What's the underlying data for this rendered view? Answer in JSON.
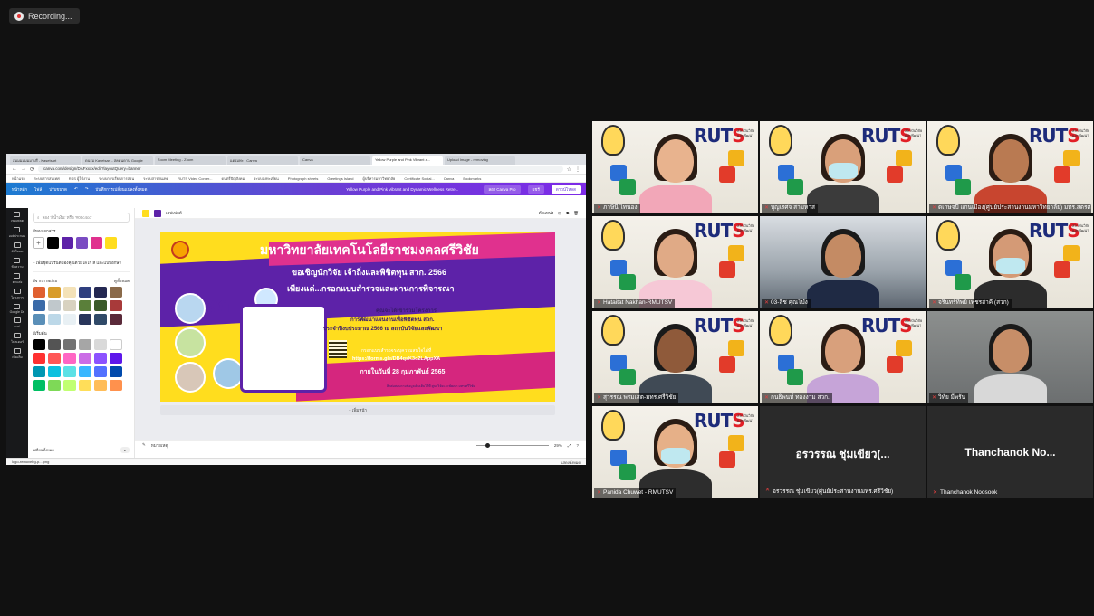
{
  "recording": {
    "label": "Recording..."
  },
  "share": {
    "tabs": [
      "สมมมมมมมาปรี - Kasetsart",
      "ดนรม Kasetsart - สคดนดาน Google",
      "Zoom Meeting - Zoom",
      "แดรมพะ - Canva",
      "Canva",
      "Yellow Purple and Pink Vibrant a...",
      "Upload Image - removing"
    ],
    "address": "canva.com/design/DAFxxxx/edit?layoutQuery=banner",
    "bookmarks": [
      "หน้าแรก",
      "ระบบสารสนเทศ",
      "RSS ผู้ใช้งาน",
      "ระบบการเรียนการสอน",
      "ระบบสารสนเทศ",
      "RUTS Video Confer...",
      "ดนตรีปัญสังคม",
      "ระบบลงทะเบียน",
      "Photograph sheets",
      "Greetings Island",
      "ผู้บริหารมหาวิทยาลัย",
      "Certificate Social...",
      "Canva",
      "Bookmarks"
    ],
    "canva": {
      "home": "หน้าหลัก",
      "file": "ไฟล์",
      "resize": "ปรับขนาด",
      "saved": "บันทึกการเปลี่ยนแปลงทั้งหมด",
      "doc_title": "Yellow Purple and Pink Vibrant and Dynamic Wellness Retre...",
      "try_pro": "ลอง Canva Pro",
      "share_btn": "แชร์",
      "download_btn": "ดาวน์โหลด",
      "rail": [
        "เทมเพลต",
        "องค์ประกอบ",
        "อัปโหลด",
        "ข้อความ",
        "ตกแต่ง",
        "โครงการ",
        "Google Dr.",
        "แอป",
        "โฟลเดอร์",
        "เพิ่มเติม"
      ],
      "search_placeholder": "ลอง 'สีน้ำเงิน' หรือ '#00c4cc'",
      "doc_colors_label": "สีของเอกสาร",
      "brand_link": "เพิ่มชุดแบรนด์ของคุณด้วยโลโก้ สี และแบบอักษร",
      "photo_colors_label": "สีจากภาพถ่าย",
      "photo_colors_more": "ดูทั้งหมด",
      "default_colors_label": "สีเริ่มต้น",
      "change_all": "เปลี่ยนทั้งหมด",
      "toolbar_effects": "เอฟเฟกต์",
      "toolbar_position": "ตำแหน่ง",
      "add_page": "+ เพิ่มหน้า",
      "notes": "หมายเหตุ",
      "zoom": "29%",
      "download_file": "logo-removebg-p....png",
      "show_all": "แสดงทั้งหมด",
      "banner": {
        "university": "มหาวิทยาลัยเทคโนโลยีราชมงคลศรีวิชัย",
        "invite": "ขอเชิญนักวิจัย เจ้าถิ่งและพิชิตทุน สวก. 2566",
        "only": "เพียงแค่...กรอกแบบสำรวจและผ่านการพิจารณา",
        "line1": "คุณจะได้เข้าร่วมโครงการ",
        "line2": "การพัฒนาแผนงานเพื่อพิชิตทุน สวก.",
        "line3": "ประจำปีงบประมาณ 2566 ณ สถาบันวิจัยและพัฒนา",
        "survey": "กรอกแบบสำรวจระบุความสนใจได้ที่",
        "link": "https://forms.gle/DB4qsK3o2LAppXA",
        "deadline": "ภายในวันที่ 28 กุมภาพันธ์ 2565",
        "contact": "ติดต่อสอบถามข้อมูลเพิ่มเติมได้ที่ ศูนย์วิจัยและพัฒนา มทร.ศรีวิชัย"
      }
    },
    "colors": {
      "doc": [
        "#000000",
        "#5d22a8",
        "#7a4cc2",
        "#e0318e",
        "#ffdd1e"
      ],
      "photo": [
        "#e06030",
        "#d89c2a",
        "#f4e2b8",
        "#2f3f7f",
        "#242852",
        "#8a6a4a",
        "#3a6aa8",
        "#c0c8cc",
        "#d8d2c0",
        "#5a7f3a",
        "#3a5a2a",
        "#a83a3a",
        "#5a8fb8",
        "#bcd8e8",
        "#e8f0f4",
        "#28355a",
        "#304a68",
        "#5a2a3a"
      ],
      "default": [
        "#000000",
        "#545454",
        "#737373",
        "#a6a6a6",
        "#d9d9d9",
        "#ffffff",
        "#ff3131",
        "#ff5757",
        "#ff66c4",
        "#cb6ce6",
        "#8c52ff",
        "#5e17eb",
        "#0097b2",
        "#0cc0df",
        "#5ce1e6",
        "#38b6ff",
        "#5271ff",
        "#004aad",
        "#00bf63",
        "#7ed957",
        "#c1ff72",
        "#ffde59",
        "#ffbd59",
        "#ff914d"
      ]
    }
  },
  "participants": [
    {
      "name": "ภาษินี  ไทนอง",
      "type": "rut"
    },
    {
      "name": "บุญเรศจ  สามหาส",
      "type": "rut"
    },
    {
      "name": "ดเกษจปี  แกนเมือง(ศูนย์ประสานงานมหาวิทยาลัย) มทร.สตรศรีราช",
      "type": "rut"
    },
    {
      "name": "Hataitat Nakhan-RMUTSV",
      "type": "rut"
    },
    {
      "name": "03-ลีช  คุณโป่ง",
      "type": "office"
    },
    {
      "name": "จรินทร์ทิพย์  เพชรสาคี (สวก)",
      "type": "rut"
    },
    {
      "name": "สุวรรณ  พรมเสต-มทร.ศรีวิชัย",
      "type": "rut"
    },
    {
      "name": "กนธิพนท์  ทองงาม  สวก.",
      "type": "rut"
    },
    {
      "name": "วิทัย  มีพรัน",
      "type": "plain"
    },
    {
      "name": "Panida Chuwet - RMUTSV",
      "type": "rut"
    },
    {
      "name": "อรวรรณ  ชุ่มเขียว(ศูนย์ประสานงานมทร.ศรีวิชัย)",
      "display": "อรวรรณ ชุ่มเขียว(...",
      "type": "off"
    },
    {
      "name": "Thanchanok Noosook",
      "display": "Thanchanok  No...",
      "type": "off"
    }
  ],
  "rut_logo": {
    "main": "RUT",
    "accent": "S",
    "sub1": "สถาบันวิจัย",
    "sub2": "และพัฒนา"
  }
}
